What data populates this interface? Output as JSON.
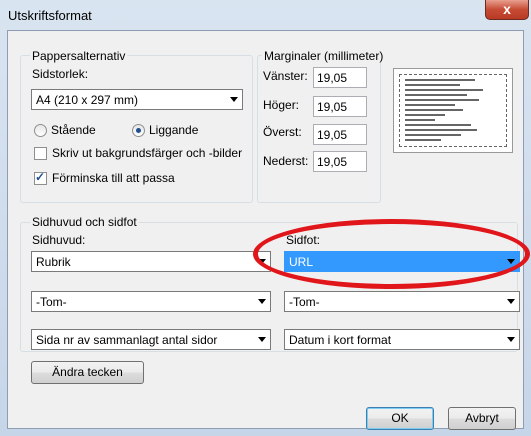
{
  "window": {
    "title": "Utskriftsformat",
    "close_glyph": "x"
  },
  "paper": {
    "legend": "Pappersalternativ",
    "size_label": "Sidstorlek:",
    "size_value": "A4 (210 x 297 mm)",
    "portrait_label": "Stående",
    "landscape_label": "Liggande",
    "orientation_selected": "Liggande",
    "background_label": "Skriv ut bakgrundsfärger och -bilder",
    "background_checked": false,
    "shrink_label": "Förminska till att passa",
    "shrink_checked": true
  },
  "margins": {
    "legend": "Marginaler (millimeter)",
    "left_label": "Vänster:",
    "left_value": "19,05",
    "right_label": "Höger:",
    "right_value": "19,05",
    "top_label": "Överst:",
    "top_value": "19,05",
    "bottom_label": "Nederst:",
    "bottom_value": "19,05"
  },
  "headerfooter": {
    "legend": "Sidhuvud och sidfot",
    "header_label": "Sidhuvud:",
    "footer_label": "Sidfot:",
    "header_1": "Rubrik",
    "header_2": "-Tom-",
    "header_3": "Sida nr av sammanlagt antal sidor",
    "footer_1": "URL",
    "footer_2": "-Tom-",
    "footer_3": "Datum i kort format",
    "font_button": "Ändra tecken"
  },
  "buttons": {
    "ok": "OK",
    "cancel": "Avbryt"
  },
  "colors": {
    "annotation": "#e0161a",
    "highlight": "#3399ff"
  }
}
